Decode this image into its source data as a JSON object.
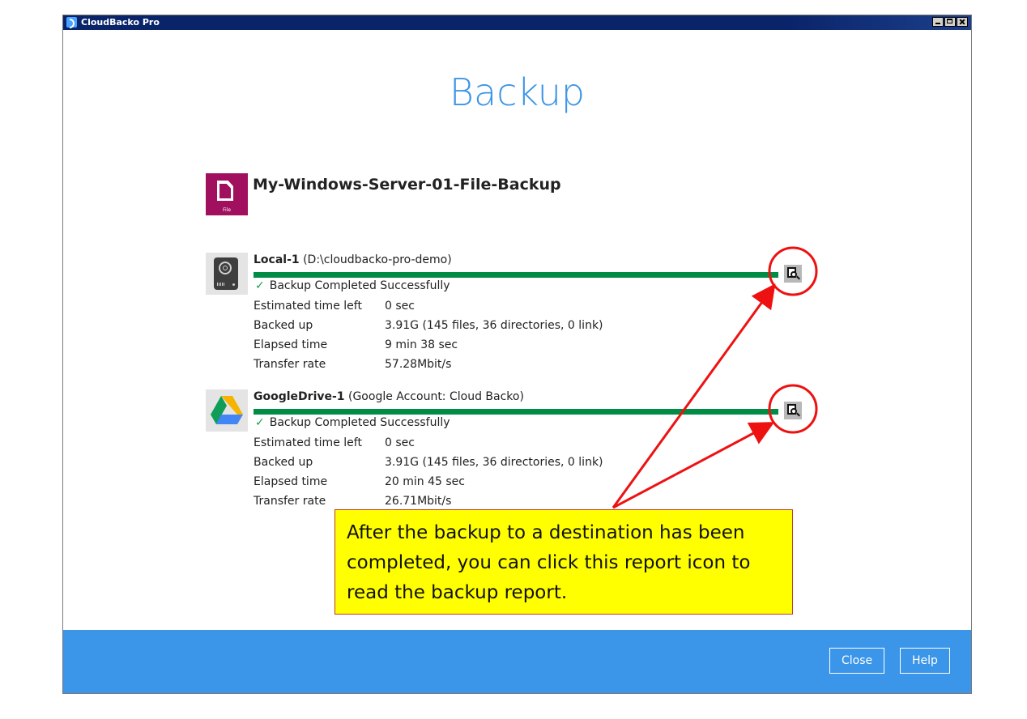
{
  "window": {
    "title": "CloudBacko Pro"
  },
  "page": {
    "title": "Backup"
  },
  "backup_set": {
    "name": "My-Windows-Server-01-File-Backup",
    "icon_label": "File"
  },
  "destinations": [
    {
      "name": "Local-1",
      "detail": " (D:\\cloudbacko-pro-demo)",
      "status": "Backup Completed Successfully",
      "progress_percent": 100,
      "rows": [
        {
          "label": "Estimated time left",
          "value": "0 sec"
        },
        {
          "label": "Backed up",
          "value": "3.91G (145 files, 36 directories, 0 link)"
        },
        {
          "label": "Elapsed time",
          "value": "9 min 38 sec"
        },
        {
          "label": "Transfer rate",
          "value": "57.28Mbit/s"
        }
      ]
    },
    {
      "name": "GoogleDrive-1",
      "detail": " (Google Account: Cloud Backo)",
      "status": "Backup Completed Successfully",
      "progress_percent": 100,
      "rows": [
        {
          "label": "Estimated time left",
          "value": "0 sec"
        },
        {
          "label": "Backed up",
          "value": "3.91G (145 files, 36 directories, 0 link)"
        },
        {
          "label": "Elapsed time",
          "value": "20 min 45 sec"
        },
        {
          "label": "Transfer rate",
          "value": "26.71Mbit/s"
        }
      ]
    }
  ],
  "callout": {
    "text": "After the backup to a destination has been completed, you can click this report icon to read the backup report."
  },
  "footer": {
    "close_label": "Close",
    "help_label": "Help"
  },
  "colors": {
    "accent": "#3b95e9",
    "progress": "#008c44",
    "annotation": "#ee1111",
    "callout_bg": "#ffff00"
  }
}
